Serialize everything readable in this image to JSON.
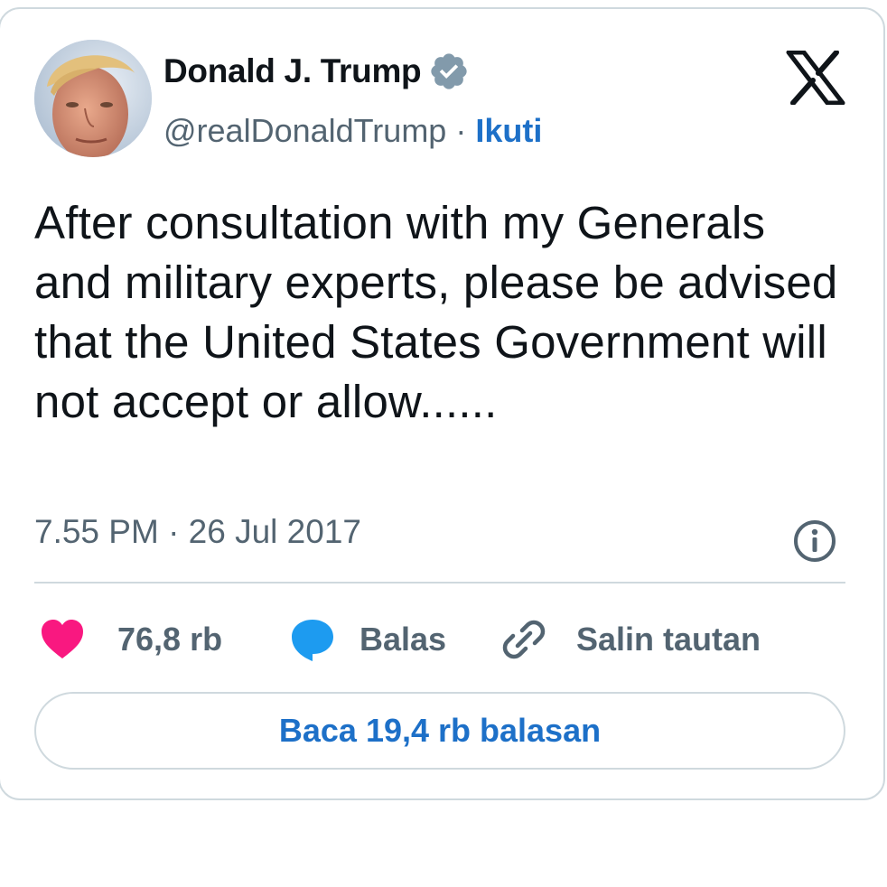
{
  "author": {
    "name": "Donald J. Trump",
    "handle": "@realDonaldTrump",
    "separator": "·",
    "follow_label": "Ikuti",
    "verified_icon": "verified-badge-icon",
    "avatar": "profile-photo"
  },
  "tweet": {
    "text": "After consultation with my Generals and military experts, please be advised that the United States Government will not accept or allow......",
    "timestamp": "7.55 PM · 26 Jul 2017"
  },
  "actions": {
    "like_count": "76,8 rb",
    "reply_label": "Balas",
    "copy_link_label": "Salin tautan"
  },
  "read_replies_label": "Baca 19,4 rb balasan",
  "colors": {
    "like": "#f91880",
    "reply": "#1d9bf0",
    "link_blue": "#1d70c8",
    "muted": "#536471",
    "text": "#0f1419",
    "border": "#cfd9de",
    "verified": "#829aab"
  },
  "icons": {
    "brand": "x-logo-icon",
    "info": "info-icon",
    "like": "heart-icon",
    "reply": "speech-bubble-icon",
    "copy_link": "link-icon"
  }
}
